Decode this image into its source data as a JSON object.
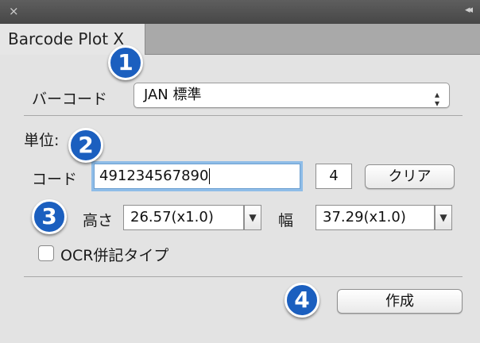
{
  "window": {
    "close_glyph": "×",
    "collapse_glyph": "◂◂"
  },
  "tab": {
    "label": "Barcode Plot X"
  },
  "barcode_type": {
    "label": "バーコード",
    "selected": "JAN 標準",
    "arrows": "⬍"
  },
  "unit_section": {
    "label": "単位:"
  },
  "code": {
    "label": "コード",
    "value": "491234567890",
    "check_digit": "4",
    "clear_button": "クリア"
  },
  "size": {
    "height_label": "高さ",
    "height_value": "26.57(x1.0)",
    "width_label": "幅",
    "width_value": "37.29(x1.0)",
    "dropdown_glyph": "▼"
  },
  "ocr": {
    "label": "OCR併記タイプ",
    "checked": false
  },
  "create_button": "作成",
  "badges": {
    "one": "1",
    "two": "2",
    "three": "3",
    "four": "4"
  },
  "colors": {
    "badge": "#1b5fbf",
    "focus_ring": "#8fbde8",
    "titlebar": "#4f4f4f"
  }
}
